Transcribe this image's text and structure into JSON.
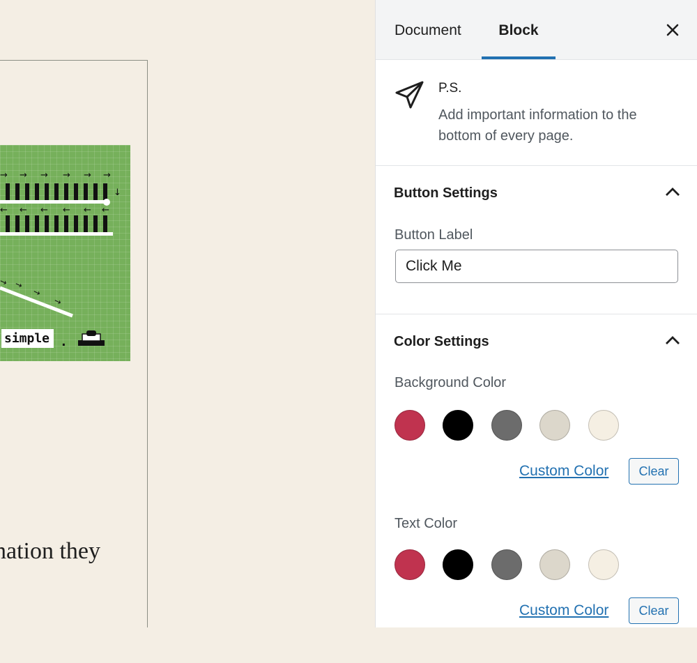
{
  "canvas": {
    "card_label": "simple",
    "card_label_suffix": ".",
    "body_text": "nation they"
  },
  "sidebar": {
    "tabs": [
      {
        "label": "Document",
        "active": false
      },
      {
        "label": "Block",
        "active": true
      }
    ],
    "close_icon": "close-icon",
    "block": {
      "icon": "paper-plane-icon",
      "title": "P.S.",
      "description": "Add important information to the bottom of every page."
    },
    "button_settings": {
      "heading": "Button Settings",
      "expanded": true,
      "label_field": {
        "label": "Button Label",
        "value": "Click Me"
      }
    },
    "color_settings": {
      "heading": "Color Settings",
      "expanded": true,
      "background": {
        "label": "Background Color",
        "swatches": [
          "#c0334f",
          "#000000",
          "#6c6c6c",
          "#dcd7cb",
          "#f5efe3"
        ],
        "custom_label": "Custom Color",
        "clear_label": "Clear"
      },
      "text": {
        "label": "Text Color",
        "swatches": [
          "#c0334f",
          "#000000",
          "#6c6c6c",
          "#dcd7cb",
          "#f5efe3"
        ],
        "custom_label": "Custom Color",
        "clear_label": "Clear"
      }
    }
  },
  "colors": {
    "accent": "#2271b1",
    "canvas_bg": "#f4eee4",
    "card_green": "#76b05b"
  }
}
